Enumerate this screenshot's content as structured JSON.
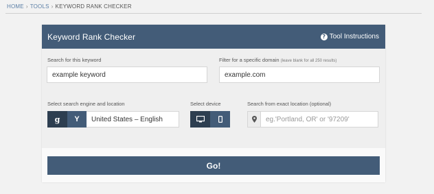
{
  "breadcrumb": {
    "home": "HOME",
    "tools": "TOOLS",
    "current": "KEYWORD RANK CHECKER",
    "separator": "›"
  },
  "panel": {
    "title": "Keyword Rank Checker",
    "instructions_label": "Tool Instructions",
    "instructions_icon": "?"
  },
  "form": {
    "keyword_label": "Search for this keyword",
    "keyword_value": "example keyword",
    "domain_label": "Filter for a specific domain",
    "domain_hint": "(leave blank for all 250 results)",
    "domain_value": "example.com",
    "engine_label": "Select search engine and location",
    "google_label": "g",
    "yahoo_label": "Y",
    "location_value": "United States – English",
    "device_label": "Select device",
    "exact_location_label": "Search from exact location (optional)",
    "exact_location_placeholder": "eg.'Portland, OR' or '97209'"
  },
  "go_label": "Go!",
  "colors": {
    "header": "#435c78",
    "active_segment": "#2d3e50",
    "link": "#5b7fa6"
  }
}
